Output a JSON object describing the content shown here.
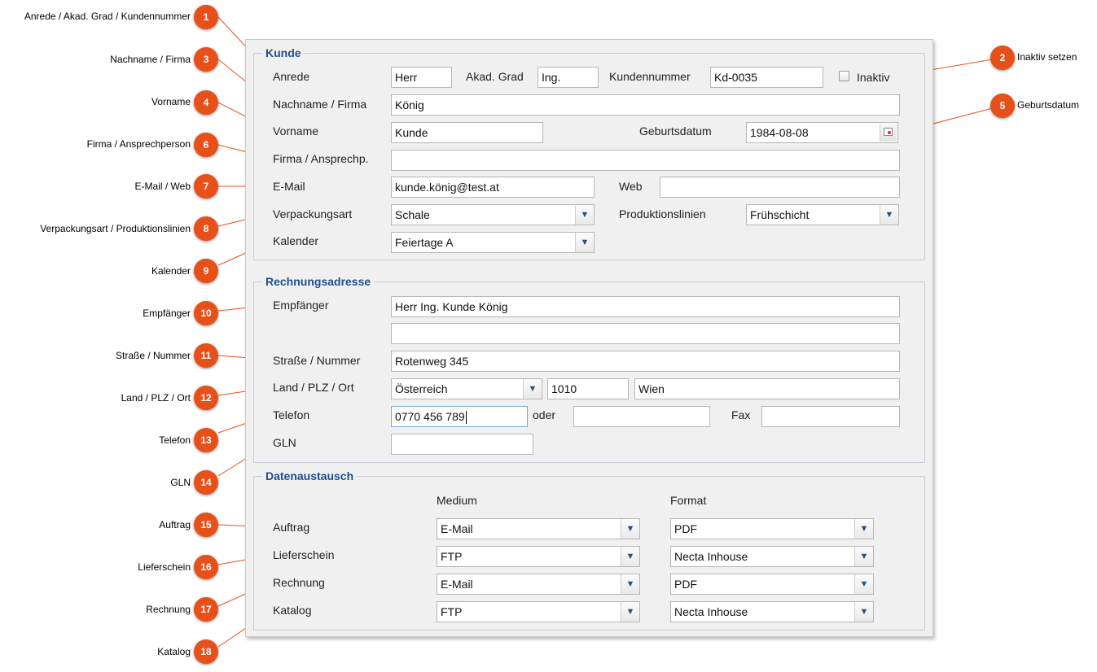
{
  "callouts": [
    {
      "n": "1",
      "text": "Anrede / Akad. Grad / Kundennummer"
    },
    {
      "n": "2",
      "text": "Inaktiv setzen"
    },
    {
      "n": "3",
      "text": "Nachname / Firma"
    },
    {
      "n": "4",
      "text": "Vorname"
    },
    {
      "n": "5",
      "text": "Geburtsdatum"
    },
    {
      "n": "6",
      "text": "Firma / Ansprechperson"
    },
    {
      "n": "7",
      "text": "E-Mail / Web"
    },
    {
      "n": "8",
      "text": "Verpackungsart / Produktionslinien"
    },
    {
      "n": "9",
      "text": "Kalender"
    },
    {
      "n": "10",
      "text": "Empfänger"
    },
    {
      "n": "11",
      "text": "Straße / Nummer"
    },
    {
      "n": "12",
      "text": "Land / PLZ / Ort"
    },
    {
      "n": "13",
      "text": "Telefon"
    },
    {
      "n": "14",
      "text": "GLN"
    },
    {
      "n": "15",
      "text": "Auftrag"
    },
    {
      "n": "16",
      "text": "Lieferschein"
    },
    {
      "n": "17",
      "text": "Rechnung"
    },
    {
      "n": "18",
      "text": "Katalog"
    }
  ],
  "colors": {
    "badge": "#e8501a",
    "leader": "#e8501a",
    "legend": "#1f4e8c",
    "panel": "#f0f0f0"
  },
  "kunde": {
    "title": "Kunde",
    "anrede_label": "Anrede",
    "anrede_value": "Herr",
    "akad_label": "Akad. Grad",
    "akad_value": "Ing.",
    "kundennummer_label": "Kundennummer",
    "kundennummer_value": "Kd-0035",
    "inaktiv_label": "Inaktiv",
    "inaktiv_checked": false,
    "nachname_label": "Nachname / Firma",
    "nachname_value": "König",
    "vorname_label": "Vorname",
    "vorname_value": "Kunde",
    "geburtsdatum_label": "Geburtsdatum",
    "geburtsdatum_value": "1984-08-08",
    "firma_label": "Firma / Ansprechp.",
    "firma_value": "",
    "email_label": "E-Mail",
    "email_value": "kunde.könig@test.at",
    "web_label": "Web",
    "web_value": "",
    "verpackung_label": "Verpackungsart",
    "verpackung_value": "Schale",
    "produktion_label": "Produktionslinien",
    "produktion_value": "Frühschicht",
    "kalender_label": "Kalender",
    "kalender_value": "Feiertage A"
  },
  "rechnung": {
    "title": "Rechnungsadresse",
    "empfaenger_label": "Empfänger",
    "empfaenger_value": "Herr Ing. Kunde König",
    "empfaenger2_value": "",
    "strasse_label": "Straße / Nummer",
    "strasse_value": "Rotenweg 345",
    "land_label": "Land / PLZ / Ort",
    "land_value": "Österreich",
    "plz_value": "1010",
    "ort_value": "Wien",
    "telefon_label": "Telefon",
    "telefon_value": "0770 456 789",
    "oder_label": "oder",
    "telefon2_value": "",
    "fax_label": "Fax",
    "fax_value": "",
    "gln_label": "GLN",
    "gln_value": ""
  },
  "daten": {
    "title": "Datenaustausch",
    "medium_header": "Medium",
    "format_header": "Format",
    "rows": [
      {
        "label": "Auftrag",
        "medium": "E-Mail",
        "format": "PDF"
      },
      {
        "label": "Lieferschein",
        "medium": "FTP",
        "format": "Necta Inhouse"
      },
      {
        "label": "Rechnung",
        "medium": "E-Mail",
        "format": "PDF"
      },
      {
        "label": "Katalog",
        "medium": "FTP",
        "format": "Necta Inhouse"
      }
    ]
  },
  "icons": {
    "dropdown": "chevron-down-icon",
    "calendar": "calendar-icon"
  }
}
